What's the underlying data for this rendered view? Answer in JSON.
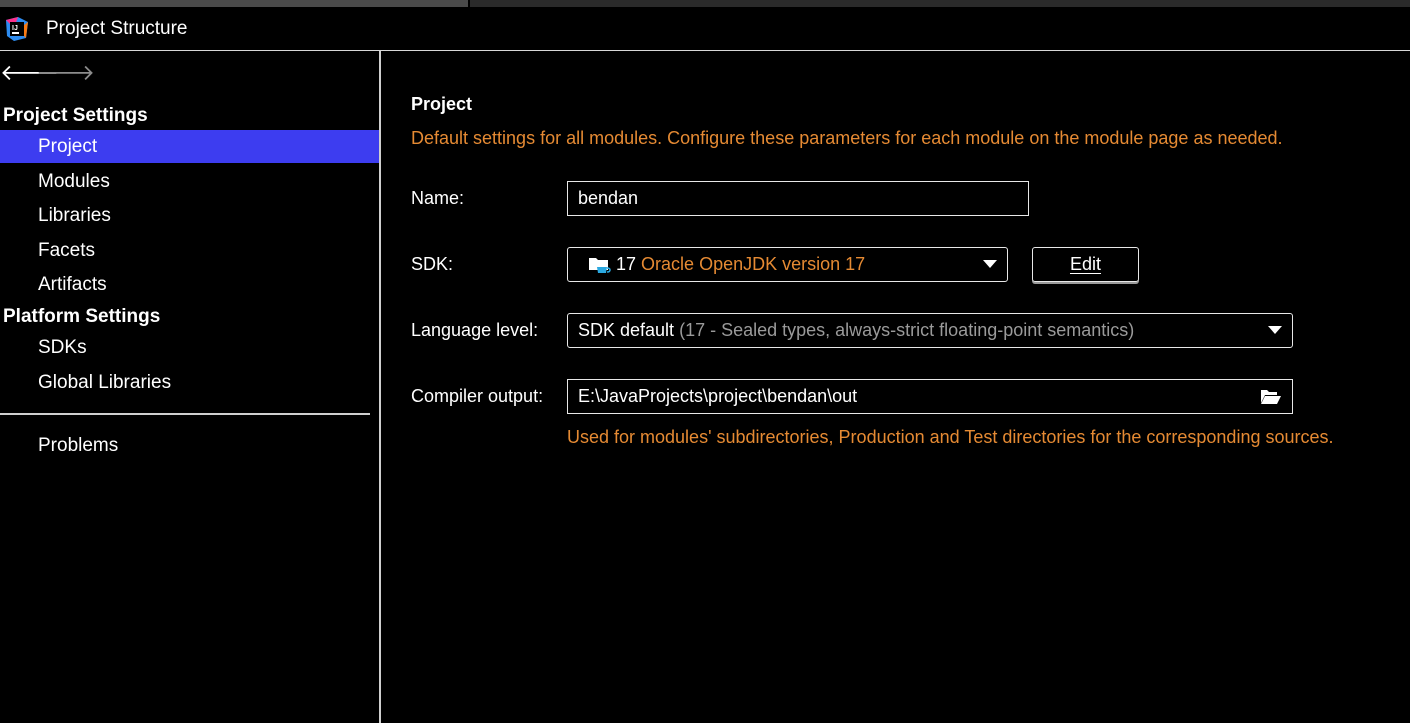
{
  "window": {
    "title": "Project Structure",
    "app_icon": "intellij-icon"
  },
  "sidebar": {
    "nav_back_icon": "arrow-left-icon",
    "nav_forward_icon": "arrow-right-icon",
    "groups": [
      {
        "header": "Project Settings",
        "items": [
          "Project",
          "Modules",
          "Libraries",
          "Facets",
          "Artifacts"
        ]
      },
      {
        "header": "Platform Settings",
        "items": [
          "SDKs",
          "Global Libraries"
        ]
      }
    ],
    "problems": "Problems",
    "selected_item": "Project"
  },
  "main": {
    "title": "Project",
    "description": "Default settings for all modules. Configure these parameters for each module on the module page as needed.",
    "name_label": "Name:",
    "name_value": "bendan",
    "sdk_label": "SDK:",
    "sdk_version": "17",
    "sdk_name": "Oracle OpenJDK version 17",
    "edit_button": "Edit",
    "language_level_label": "Language level:",
    "language_level_value": "SDK default",
    "language_level_detail": "(17 - Sealed types, always-strict floating-point semantics)",
    "compiler_output_label": "Compiler output:",
    "compiler_output_value": "E:\\JavaProjects\\project\\bendan\\out",
    "compiler_output_hint": "Used for modules' subdirectories, Production and Test directories for the corresponding sources."
  },
  "colors": {
    "background": "#000000",
    "selection": "#3d3df0",
    "accent_orange": "#e58a33"
  }
}
